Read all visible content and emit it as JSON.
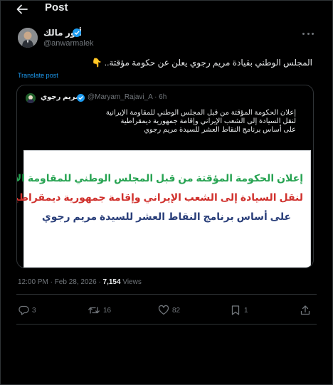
{
  "header": {
    "title": "Post"
  },
  "author": {
    "name": "أنور مالك",
    "handle": "@anwarmalek"
  },
  "tweet": {
    "text": "المجلس الوطني بقيادة مريم رجوي يعلن عن حكومة مؤقتة..",
    "emoji": "👇",
    "translate_label": "Translate post"
  },
  "quote": {
    "name": "مريم رجوي",
    "meta": "@Maryam_Rajavi_A · 6h",
    "lines": [
      "إعلان الحكومة المؤقتة من قبل المجلس الوطني للمقاومة الإيرانية",
      "لنقل السيادة إلى الشعب الإيراني وإقامة جمهورية ديمقراطية",
      "على أساس برنامج النقاط العشر للسيدة مريم رجوي"
    ],
    "image_lines": [
      "إعلان الحكومة المؤقتة من قبل المجلس الوطني للمقاومة الإيرانية",
      "لنقل السيادة إلى الشعب الإيراني وإقامة جمهورية ديمقراطية",
      "على أساس برنامج النقاط العشر للسيدة مريم رجوي"
    ],
    "image_colors": [
      "#27a352",
      "#d0312d",
      "#2a3f7a"
    ]
  },
  "timestamp": "12:00 PM · Feb 28, 2026 · ",
  "views": {
    "count": "7,154",
    "label": " Views"
  },
  "actions": {
    "reply_count": "3",
    "retweet_count": "16",
    "like_count": "82",
    "bookmark_count": "1"
  },
  "icons": {
    "back": "back-arrow-icon",
    "verified": "verified-badge-icon",
    "more": "more-options-icon",
    "reply": "reply-icon",
    "retweet": "retweet-icon",
    "like": "heart-icon",
    "bookmark": "bookmark-icon",
    "share": "share-icon"
  },
  "colors": {
    "accent": "#1d9bf0",
    "background": "#000000",
    "muted": "#71767b"
  }
}
